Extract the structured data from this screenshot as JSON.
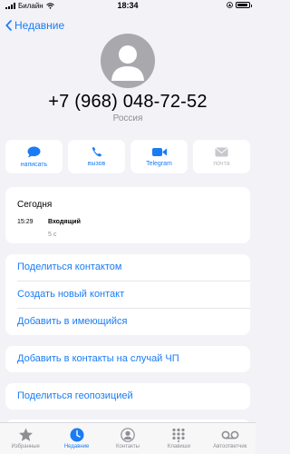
{
  "status_bar": {
    "carrier": "Билайн",
    "time": "18:34"
  },
  "nav": {
    "back_label": "Недавние"
  },
  "contact": {
    "phone": "+7 (968) 048-72-52",
    "country": "Россия"
  },
  "actions": [
    {
      "label": "написать",
      "icon": "message-icon"
    },
    {
      "label": "вызов",
      "icon": "phone-icon"
    },
    {
      "label": "Telegram",
      "icon": "video-icon"
    },
    {
      "label": "почта",
      "icon": "mail-icon"
    }
  ],
  "history": {
    "title": "Сегодня",
    "time": "15:29",
    "type": "Входящий",
    "duration": "5 с"
  },
  "list1": [
    "Поделиться контактом",
    "Создать новый контакт",
    "Добавить в имеющийся"
  ],
  "list2": "Добавить в контакты на случай ЧП",
  "list3": "Поделиться геопозицией",
  "tabs": [
    {
      "label": "Избранные",
      "icon": "star-icon"
    },
    {
      "label": "Недавние",
      "icon": "clock-icon",
      "active": true
    },
    {
      "label": "Контакты",
      "icon": "contact-icon"
    },
    {
      "label": "Клавиши",
      "icon": "keypad-icon"
    },
    {
      "label": "Автоответчик",
      "icon": "voicemail-icon"
    }
  ],
  "colors": {
    "accent": "#1a7cf5",
    "background": "#f2f2f7",
    "avatar": "#a8a8ad"
  }
}
